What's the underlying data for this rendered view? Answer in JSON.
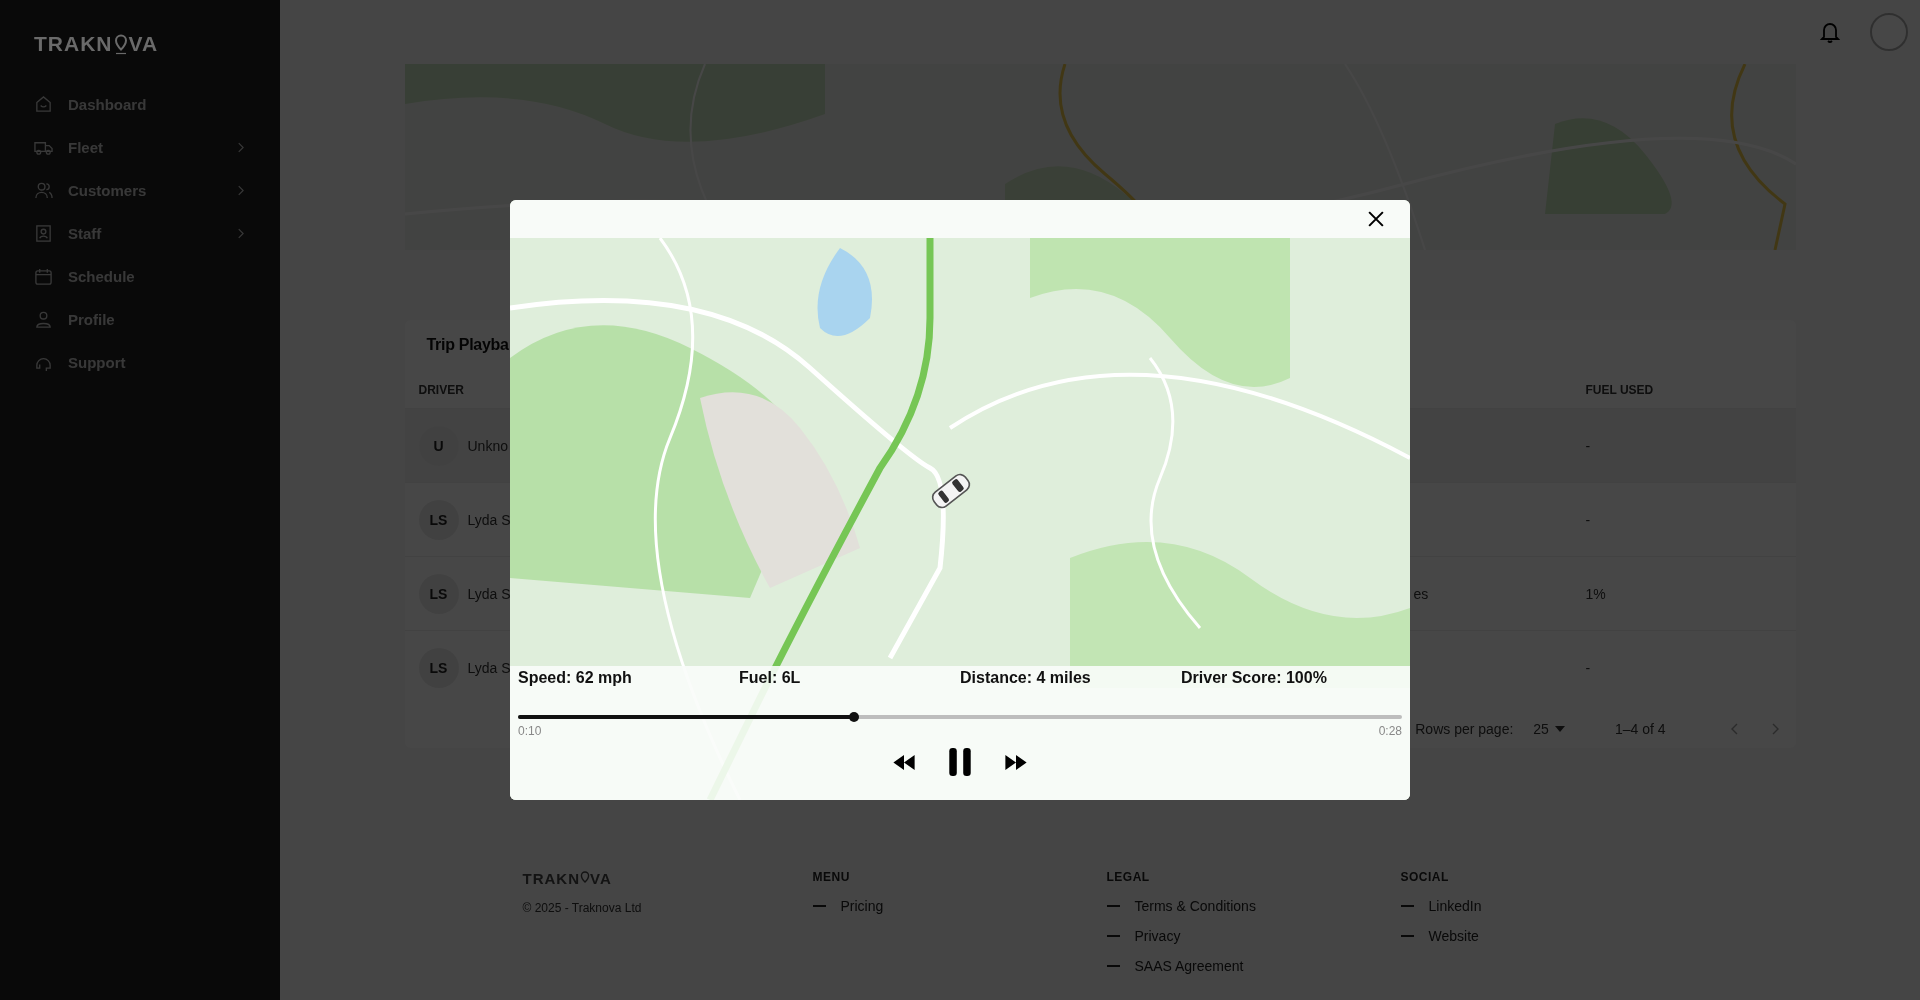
{
  "sidebar": {
    "logo": {
      "start": "TRAKN",
      "end": "VA"
    },
    "items": [
      {
        "label": "Dashboard",
        "expandable": false
      },
      {
        "label": "Fleet",
        "expandable": true
      },
      {
        "label": "Customers",
        "expandable": true
      },
      {
        "label": "Staff",
        "expandable": true
      },
      {
        "label": "Schedule",
        "expandable": false
      },
      {
        "label": "Profile",
        "expandable": false
      },
      {
        "label": "Support",
        "expandable": false
      }
    ]
  },
  "trip_table": {
    "title": "Trip Playba",
    "columns": [
      "DRIVER",
      "FUEL USED"
    ],
    "rows": [
      {
        "initials": "U",
        "driver": "Unkno",
        "column_2": "",
        "fuel_used": "-"
      },
      {
        "initials": "LS",
        "driver": "Lyda S",
        "column_2": "",
        "fuel_used": "-"
      },
      {
        "initials": "LS",
        "driver": "Lyda S",
        "column_2": "es",
        "fuel_used": "1%"
      },
      {
        "initials": "LS",
        "driver": "Lyda S",
        "column_2": "",
        "fuel_used": "-"
      }
    ],
    "pagination": {
      "rows_label": "Rows per page:",
      "rows_value": "25",
      "range": "1–4 of 4"
    }
  },
  "footer": {
    "logo": {
      "start": "TRAKN",
      "end": "VA"
    },
    "copyright": "© 2025 - Traknova Ltd",
    "columns": [
      {
        "heading": "MENU",
        "links": [
          "Pricing"
        ]
      },
      {
        "heading": "LEGAL",
        "links": [
          "Terms & Conditions",
          "Privacy",
          "SAAS Agreement"
        ]
      },
      {
        "heading": "SOCIAL",
        "links": [
          "LinkedIn",
          "Website"
        ]
      }
    ]
  },
  "playback_modal": {
    "stats": [
      "Speed: 62 mph",
      "Fuel: 6L",
      "Distance: 4 miles",
      "Driver Score: 100%"
    ],
    "progress": {
      "level": 0.38,
      "start": "0:10",
      "end": "0:28"
    },
    "playing": true
  }
}
